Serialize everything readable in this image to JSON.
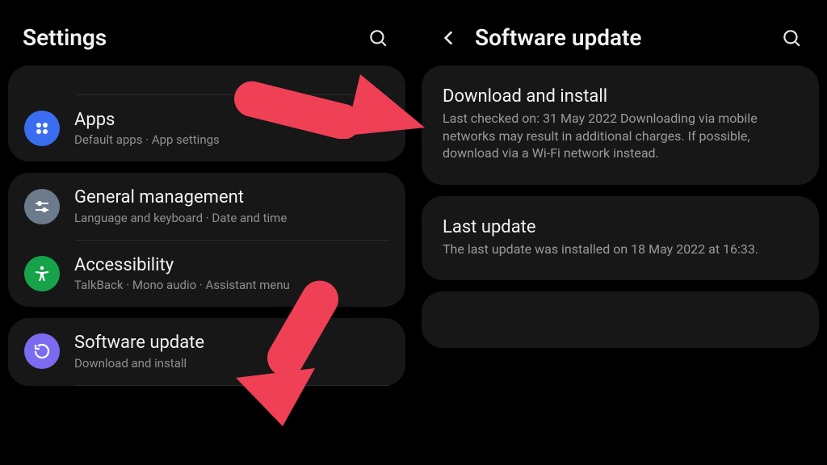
{
  "left_header": {
    "title": "Settings"
  },
  "right_header": {
    "title": "Software update"
  },
  "settings": {
    "apps": {
      "title": "Apps",
      "sub": "Default apps  ·  App settings"
    },
    "gen": {
      "title": "General management",
      "sub": "Language and keyboard  ·  Date and time"
    },
    "acc": {
      "title": "Accessibility",
      "sub": "TalkBack  ·  Mono audio  ·  Assistant menu"
    },
    "sw": {
      "title": "Software update",
      "sub": "Download and install"
    }
  },
  "update": {
    "download": {
      "title": "Download and install",
      "sub": "Last checked on: 31 May 2022\nDownloading via mobile networks may result in additional charges. If possible, download via a Wi-Fi network instead."
    },
    "last": {
      "title": "Last update",
      "sub": "The last update was installed on 18 May 2022 at 16:33."
    }
  }
}
